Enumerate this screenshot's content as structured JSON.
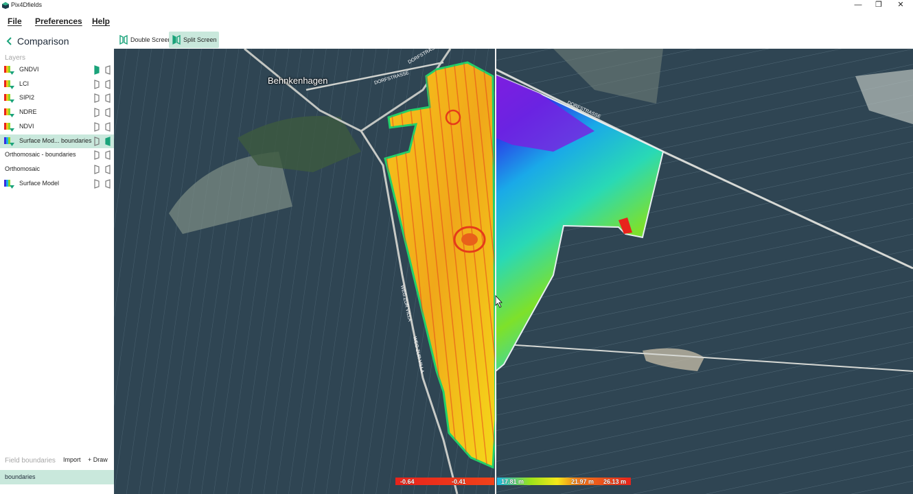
{
  "window": {
    "title": "Pix4Dfields",
    "app_icon": "pix4d-logo-icon",
    "controls": {
      "minimize": "—",
      "restore": "❐",
      "close": "✕"
    }
  },
  "menu": {
    "file": "File",
    "preferences": "Preferences",
    "help": "Help"
  },
  "sidebar": {
    "back_icon": "chevron-left-icon",
    "title": "Comparison",
    "layers_label": "Layers",
    "layers": [
      {
        "label": "GNDVI",
        "icon": "index-map-icon",
        "selected": false,
        "left_visible": true,
        "right_visible": false
      },
      {
        "label": "LCI",
        "icon": "index-map-icon",
        "selected": false,
        "left_visible": false,
        "right_visible": false
      },
      {
        "label": "SIPI2",
        "icon": "index-map-icon",
        "selected": false,
        "left_visible": false,
        "right_visible": false
      },
      {
        "label": "NDRE",
        "icon": "index-map-icon",
        "selected": false,
        "left_visible": false,
        "right_visible": false
      },
      {
        "label": "NDVI",
        "icon": "index-map-icon",
        "selected": false,
        "left_visible": false,
        "right_visible": false
      },
      {
        "label": "Surface Mod... boundaries",
        "icon": "surface-model-icon",
        "selected": true,
        "left_visible": false,
        "right_visible": true
      },
      {
        "label": "Orthomosaic - boundaries",
        "icon": "",
        "selected": false,
        "left_visible": false,
        "right_visible": false
      },
      {
        "label": "Orthomosaic",
        "icon": "",
        "selected": false,
        "left_visible": false,
        "right_visible": false
      },
      {
        "label": "Surface Model",
        "icon": "surface-model-icon",
        "selected": false,
        "left_visible": false,
        "right_visible": false
      }
    ],
    "field_boundaries_label": "Field boundaries",
    "import_label": "Import",
    "draw_label": "+ Draw",
    "boundaries": [
      {
        "label": "boundaries"
      }
    ]
  },
  "view_tabs": [
    {
      "label": "Double Screen",
      "icon": "double-screen-icon",
      "active": false
    },
    {
      "label": "Split Screen",
      "icon": "split-screen-icon",
      "active": true
    }
  ],
  "map": {
    "town_label": "Behnkenhagen",
    "street_labels": [
      "DORFSTRASSE",
      "DORFSTRASSE",
      "DORFSTRASSE",
      "WEG ZUR VILLA",
      "WEG ZUR VILLA"
    ],
    "left_legend": {
      "min": "-0.64",
      "max": "-0.41"
    },
    "right_legend": {
      "min": "17.81 m",
      "mid": "21.97 m",
      "max": "26.13 m"
    }
  },
  "colors": {
    "accent": "#1aa37a",
    "selected_bg": "#c9e8dc",
    "satellite_base": "#2e4452",
    "divider": "#f2f2f2"
  }
}
